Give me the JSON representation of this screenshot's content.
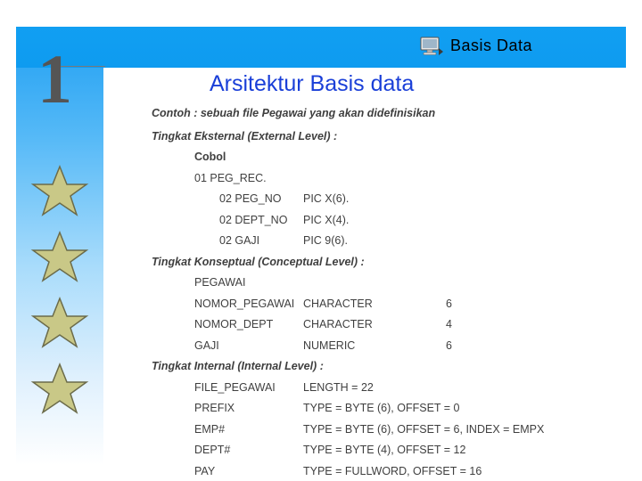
{
  "header": {
    "title": "Basis Data",
    "icon": "computer-monitor-icon"
  },
  "decor": {
    "slide_number": "1",
    "stars": [
      "star-icon",
      "star-icon",
      "star-icon",
      "star-icon"
    ],
    "accent_color": "#0c9ef2",
    "title_color": "#1a3fd8"
  },
  "slide": {
    "title": "Arsitektur Basis data",
    "intro": "Contoh : sebuah file Pegawai yang akan didefinisikan",
    "sections": [
      {
        "heading": "Tingkat Eksternal (External Level) :",
        "rows": [
          {
            "col1": "Cobol",
            "col2": "",
            "col3": "",
            "indent": 1,
            "bold": true
          },
          {
            "col1": "01 PEG_REC.",
            "col2": "",
            "col3": "",
            "indent": 1,
            "bold": false
          },
          {
            "col1": "02 PEG_NO",
            "col2": "PIC X(6).",
            "col3": "",
            "indent": 2,
            "bold": false
          },
          {
            "col1": "02 DEPT_NO",
            "col2": "PIC X(4).",
            "col3": "",
            "indent": 2,
            "bold": false
          },
          {
            "col1": "02 GAJI",
            "col2": "PIC 9(6).",
            "col3": "",
            "indent": 2,
            "bold": false
          }
        ]
      },
      {
        "heading": "Tingkat Konseptual (Conceptual Level) :",
        "rows": [
          {
            "col1": "PEGAWAI",
            "col2": "",
            "col3": "",
            "indent": 1,
            "bold": false
          },
          {
            "col1": "NOMOR_PEGAWAI",
            "col2": "CHARACTER",
            "col3": "6",
            "indent": 1,
            "bold": false
          },
          {
            "col1": "NOMOR_DEPT",
            "col2": "CHARACTER",
            "col3": "4",
            "indent": 1,
            "bold": false
          },
          {
            "col1": "GAJI",
            "col2": "NUMERIC",
            "col3": "6",
            "indent": 1,
            "bold": false
          }
        ]
      },
      {
        "heading": "Tingkat Internal (Internal Level) :",
        "rows": [
          {
            "col1": "FILE_PEGAWAI",
            "col2": "LENGTH = 22",
            "col3": "",
            "indent": 1,
            "bold": false
          },
          {
            "col1": "PREFIX",
            "col2": "TYPE = BYTE (6), OFFSET = 0",
            "col3": "",
            "indent": 1,
            "bold": false
          },
          {
            "col1": "EMP#",
            "col2": "TYPE = BYTE (6), OFFSET = 6, INDEX = EMPX",
            "col3": "",
            "indent": 1,
            "bold": false
          },
          {
            "col1": "DEPT#",
            "col2": "TYPE = BYTE (4), OFFSET = 12",
            "col3": "",
            "indent": 1,
            "bold": false
          },
          {
            "col1": "PAY",
            "col2": "TYPE = FULLWORD, OFFSET = 16",
            "col3": "",
            "indent": 1,
            "bold": false
          }
        ]
      }
    ]
  }
}
